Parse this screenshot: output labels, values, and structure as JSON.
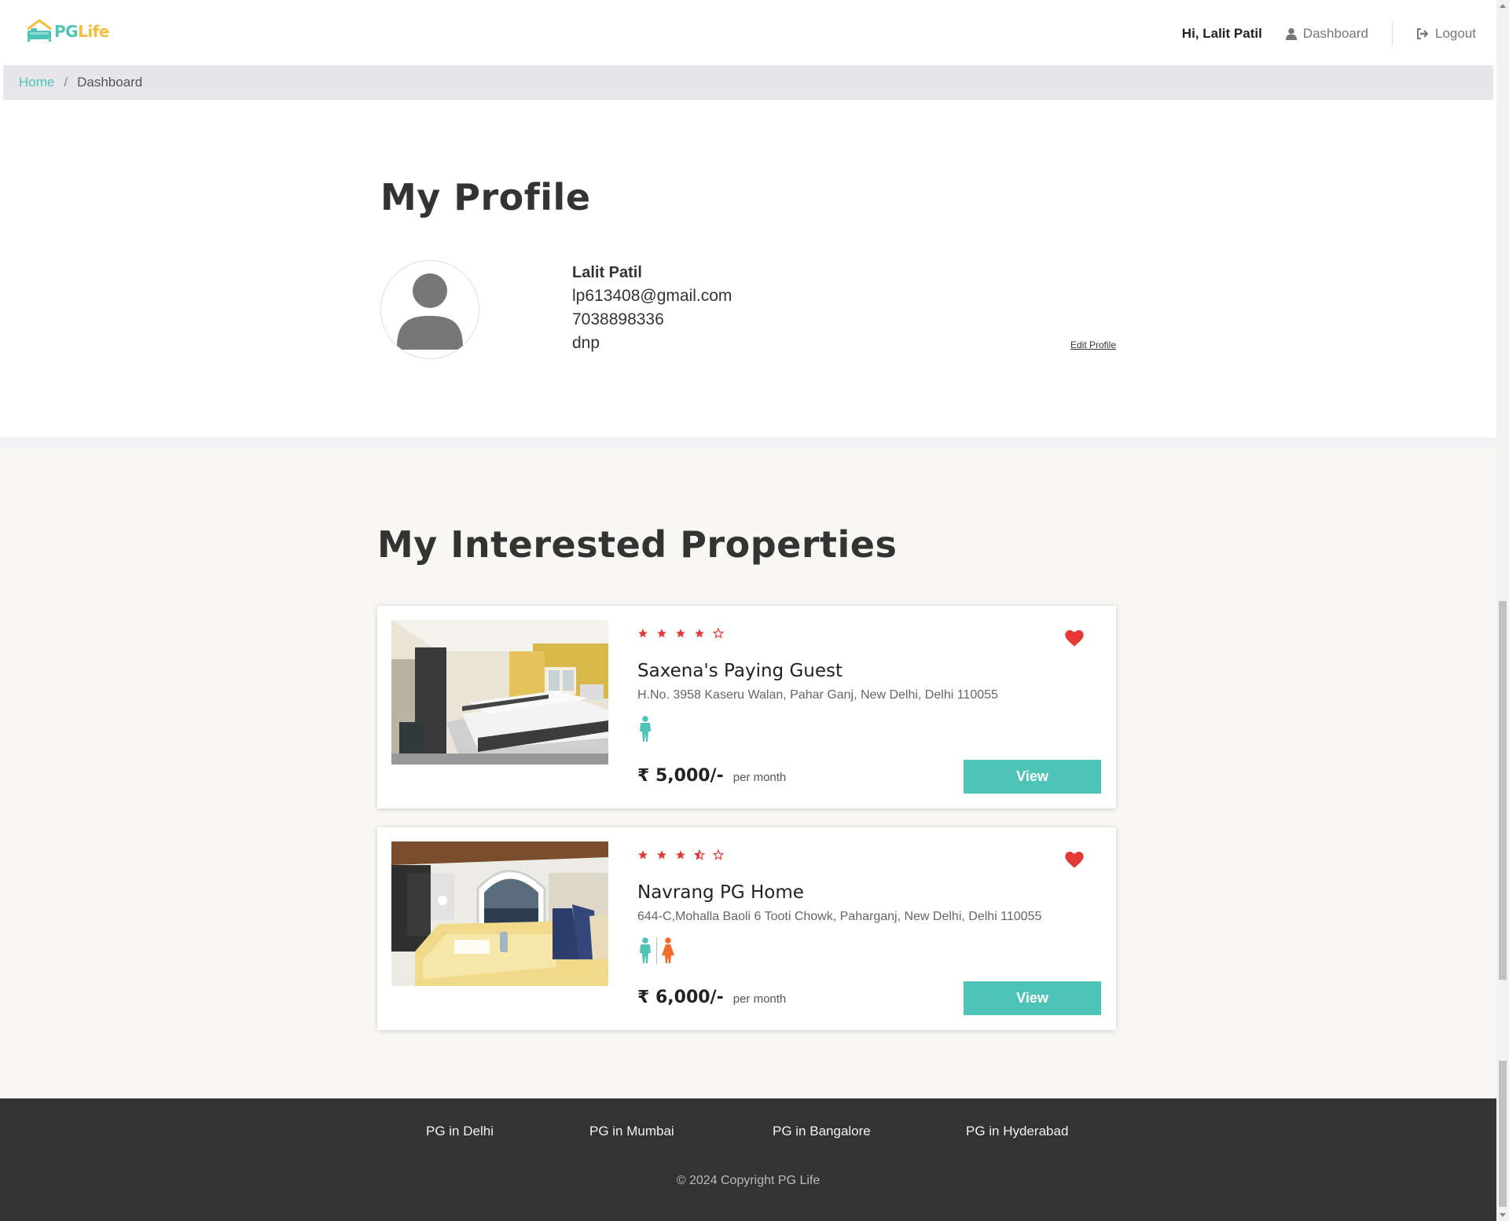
{
  "header": {
    "logo": {
      "pg": "PG",
      "life": "Life"
    },
    "greeting": "Hi, Lalit Patil",
    "dashboard_label": "Dashboard",
    "logout_label": "Logout"
  },
  "breadcrumb": {
    "home": "Home",
    "separator": "/",
    "current": "Dashboard"
  },
  "profile": {
    "title": "My Profile",
    "name": "Lalit Patil",
    "email": "lp613408@gmail.com",
    "phone": "7038898336",
    "college": "dnp",
    "edit_label": "Edit Profile"
  },
  "interested": {
    "title": "My Interested Properties",
    "properties": [
      {
        "name": "Saxena's Paying Guest",
        "address": "H.No. 3958 Kaseru Walan, Pahar Ganj, New Delhi, Delhi 110055",
        "rating": 4,
        "gender": "male",
        "price": "₹ 5,000/-",
        "per": "per month",
        "view_label": "View",
        "interested": true
      },
      {
        "name": "Navrang PG Home",
        "address": "644-C,Mohalla Baoli 6 Tooti Chowk, Paharganj, New Delhi, Delhi 110055",
        "rating": 3.5,
        "gender": "unisex",
        "price": "₹ 6,000/-",
        "per": "per month",
        "view_label": "View",
        "interested": true
      }
    ]
  },
  "footer": {
    "links": [
      "PG in Delhi",
      "PG in Mumbai",
      "PG in Bangalore",
      "PG in Hyderabad"
    ],
    "copyright": "© 2024 Copyright PG Life"
  },
  "colors": {
    "accent": "#4ec4b9",
    "star": "#e53935",
    "heart": "#e53935",
    "logo_yellow": "#f5bf3b",
    "female": "#f26b2d"
  }
}
